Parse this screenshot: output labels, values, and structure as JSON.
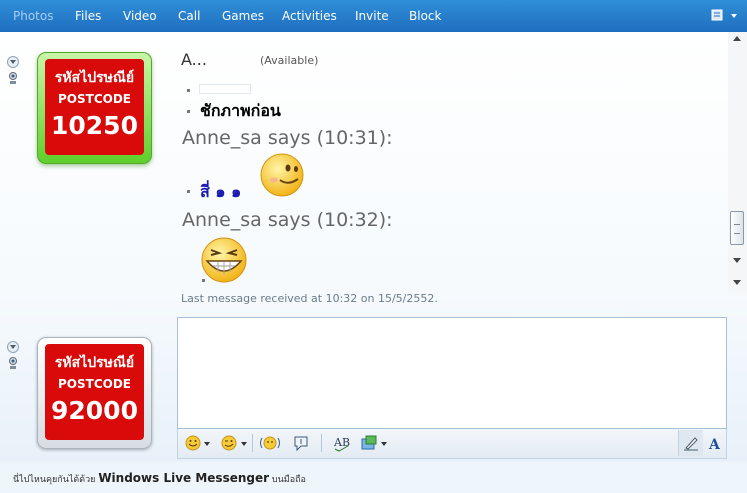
{
  "menu": {
    "items": [
      "Photos",
      "Files",
      "Video",
      "Call",
      "Games",
      "Activities",
      "Invite",
      "Block"
    ]
  },
  "contact": {
    "name": "A...",
    "status": "(Available)"
  },
  "avatars": {
    "contact": {
      "thai": "รหัสไปรษณีย์",
      "label": "POSTCODE",
      "code": "10250"
    },
    "self": {
      "thai": "รหัสไปรษณีย์",
      "label": "POSTCODE",
      "code": "92000"
    }
  },
  "conversation": {
    "line1": "ชักภาพก่อน",
    "says1": "Anne_sa says (10:31):",
    "line2": "สี่ ๑ ๑",
    "says2": "Anne_sa says (10:32):",
    "last_received": "Last message received at 10:32 on 15/5/2552."
  },
  "toolbar": {
    "icons": [
      "emoticon-icon",
      "wink-icon",
      "nudge-icon",
      "voice-clip-icon",
      "spell-check-icon",
      "background-icon",
      "handwriting-icon",
      "font-icon"
    ]
  },
  "footer": {
    "prefix": "นี่ไปไหนคุยกันได้ด้วย ",
    "brand": "Windows Live Messenger",
    "suffix": " บนมือถือ"
  },
  "colors": {
    "menubar": "#1f6fbf",
    "stamp_red": "#d80a0a",
    "frame_green": "#5fcf2a"
  }
}
